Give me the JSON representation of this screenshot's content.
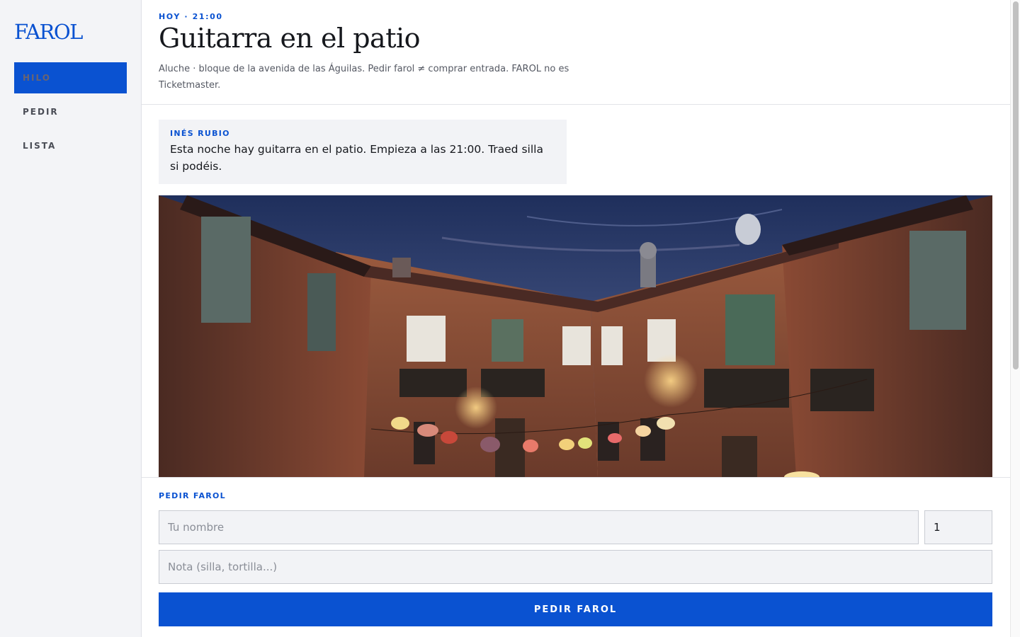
{
  "app": {
    "logo": "FAROL"
  },
  "sidebar": {
    "items": [
      {
        "label": "HILO",
        "active": true
      },
      {
        "label": "PEDIR",
        "active": false
      },
      {
        "label": "LISTA",
        "active": false
      }
    ]
  },
  "header": {
    "kicker": "HOY · 21:00",
    "title": "Guitarra en el patio",
    "subtitle": "Aluche · bloque de la avenida de las Águilas. Pedir farol ≠ comprar entrada. FAROL no es Ticketmaster."
  },
  "message": {
    "author": "INÉS RUBIO",
    "text": "Esta noche hay guitarra en el patio. Empieza a las 21:00. Traed silla si podéis."
  },
  "form": {
    "label": "PEDIR FAROL",
    "name_placeholder": "Tu nombre",
    "quantity_value": "1",
    "note_placeholder": "Nota (silla, tortilla...)",
    "submit_label": "PEDIR FAROL"
  },
  "colors": {
    "accent": "#0a52d1",
    "sidebar_bg": "#f3f4f7",
    "field_bg": "#f2f3f6"
  }
}
